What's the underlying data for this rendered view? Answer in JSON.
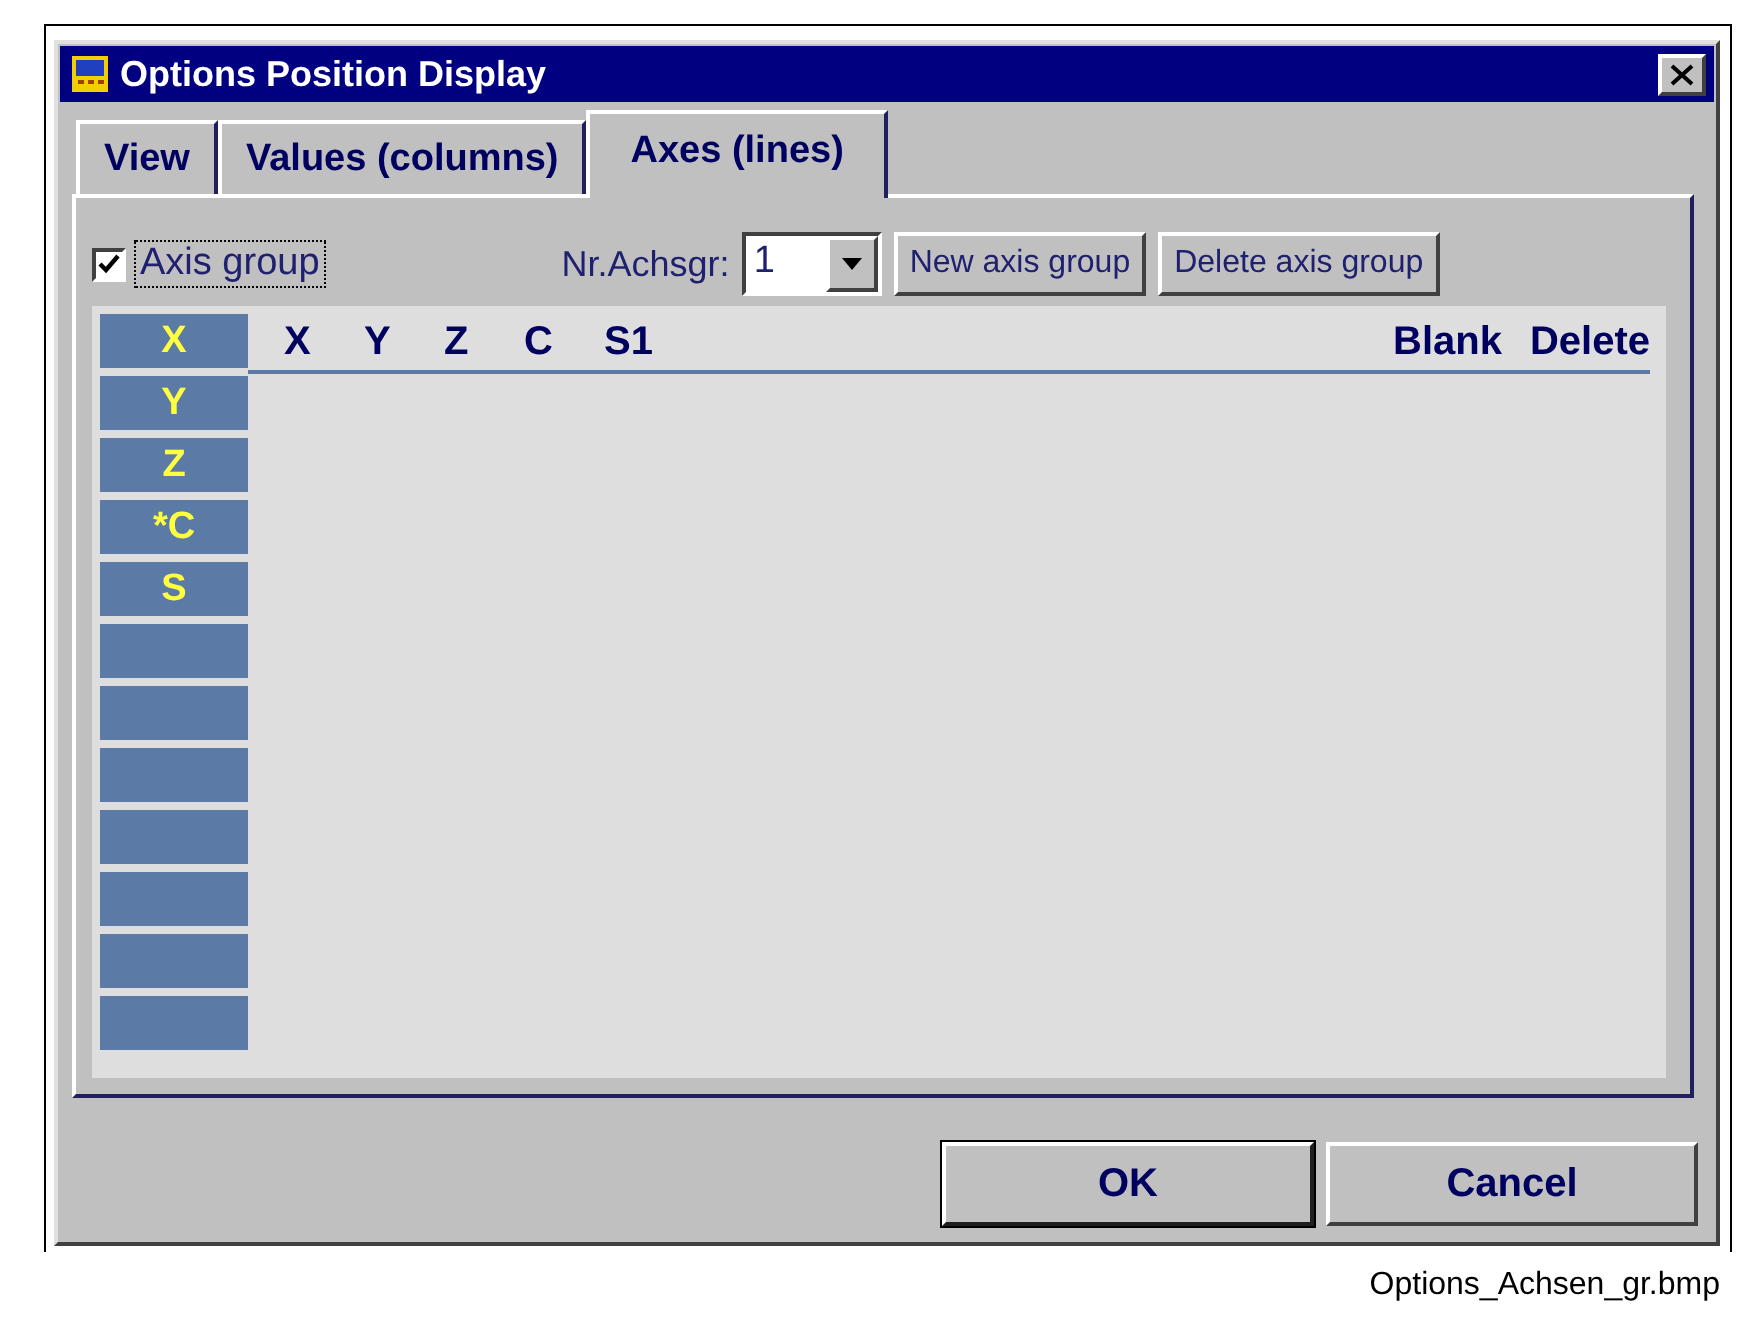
{
  "window": {
    "title": "Options Position Display"
  },
  "tabs": [
    {
      "label": "View",
      "selected": false
    },
    {
      "label": "Values (columns)",
      "selected": false
    },
    {
      "label": "Axes (lines)",
      "selected": true
    }
  ],
  "axis_group": {
    "label": "Axis group",
    "checked": true
  },
  "group_number": {
    "label": "Nr.Achsgr:",
    "value": "1"
  },
  "group_buttons": [
    "New axis group",
    "Delete axis group"
  ],
  "columns": [
    "X",
    "Y",
    "Z",
    "C",
    "S1"
  ],
  "right_columns": [
    "Blank",
    "Delete"
  ],
  "rows": [
    {
      "kind": "axis",
      "label": "X"
    },
    {
      "kind": "axis",
      "label": "Y"
    },
    {
      "kind": "axis",
      "label": "Z"
    },
    {
      "kind": "axis",
      "label": "*C"
    },
    {
      "kind": "axis",
      "label": "S"
    },
    {
      "kind": "empty"
    },
    {
      "kind": "empty"
    },
    {
      "kind": "empty"
    },
    {
      "kind": "empty"
    },
    {
      "kind": "empty"
    },
    {
      "kind": "empty"
    },
    {
      "kind": "empty"
    }
  ],
  "buttons": [
    {
      "label": "OK",
      "default": true
    },
    {
      "label": "Cancel",
      "default": false
    }
  ],
  "caption": "Options_Achsen_gr.bmp"
}
